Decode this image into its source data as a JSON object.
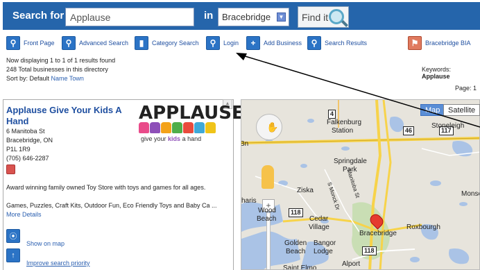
{
  "search": {
    "label": "Search for",
    "value": "Applause",
    "in_label": "in",
    "location": "Bracebridge",
    "find_button": "Find it"
  },
  "nav": {
    "items": [
      {
        "label": "Front Page",
        "icon": "magnifier-icon"
      },
      {
        "label": "Advanced Search",
        "icon": "magnifier-icon"
      },
      {
        "label": "Category Search",
        "icon": "bars-icon"
      },
      {
        "label": "Login",
        "icon": "magnifier-icon"
      },
      {
        "label": "Add Business",
        "icon": "plus-icon"
      },
      {
        "label": "Search Results",
        "icon": "magnifier-plus-icon"
      },
      {
        "label": "Bracebridge BIA",
        "icon": "flag-icon"
      }
    ]
  },
  "results": {
    "displaying": "Now displaying 1 to 1 of 1 results found",
    "total": "248 Total businesses in this directory",
    "sort_prefix": "Sort by: Default",
    "sort_links": [
      "Name",
      "Town"
    ],
    "keywords_label": "Keywords:",
    "keywords_value": "Applause",
    "page_label": "Page:",
    "page_value": "1"
  },
  "listing": {
    "title": "Applause Give Your Kids A Hand",
    "address": "6 Manitoba St",
    "city": "Bracebridge, ON",
    "postal": "P1L 1R9",
    "phone": "(705) 646-2287",
    "logo_text": "APPLAUSE!",
    "logo_tagline_pre": "give your",
    "logo_tagline_kids": "kids",
    "logo_tagline_post": "a hand",
    "description": "Award winning family owned Toy Store with toys and games for all ages.",
    "details": "Games, Puzzles, Craft Kits, Outdoor Fun, Eco Friendly Toys and Baby Ca ...",
    "more_details": "More Details",
    "show_on_map": "Show on map",
    "improve_priority": "Improve search priority"
  },
  "map": {
    "map_button": "Map",
    "satellite_button": "Satellite",
    "places": {
      "falkenburg": "Falkenburg",
      "station": "Station",
      "springdale": "Springdale",
      "park": "Park",
      "stoneleigh": "Stoneleigh",
      "ziska": "Ziska",
      "cedar": "Cedar",
      "village": "Village",
      "bracebridge": "Bracebridge",
      "roxbourgh": "Roxbourgh",
      "monsell": "Monsel",
      "golden": "Golden",
      "beach": "Beach",
      "bangor": "Bangor",
      "lodge": "Lodge",
      "alport": "Alport",
      "saint_elmo": "Saint Elmo",
      "bn": "Bn",
      "haris": "haris",
      "wood": "Wood",
      "wood2": "Beach",
      "s_monck": "S Monck Dr",
      "manitoba": "Manitoba St"
    },
    "highways": [
      "4",
      "46",
      "117",
      "118",
      "118"
    ]
  },
  "colors": {
    "header_blue": "#2565ab",
    "link_blue": "#1f4fa0",
    "map_water": "#aac3e6",
    "map_land": "#e7e4dc",
    "highway_yellow": "#f7d34a",
    "urban_green": "#c9deb4"
  }
}
